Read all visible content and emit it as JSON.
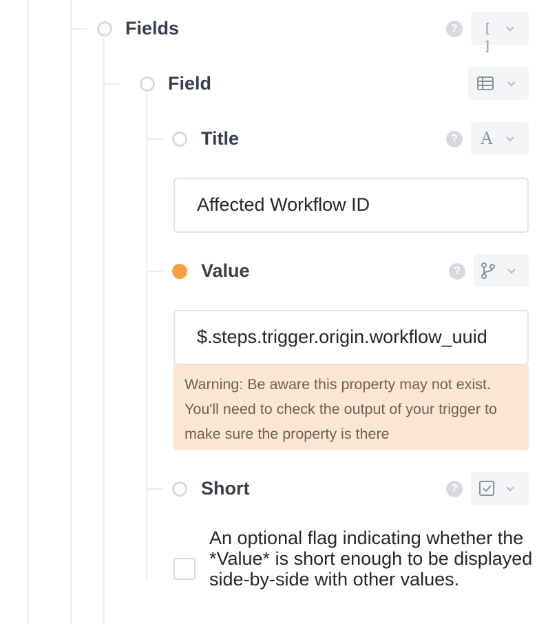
{
  "tree": {
    "fields": {
      "label": "Fields",
      "help": "?",
      "type_icon": "array-bracket-icon",
      "type_glyph": "[ ]"
    },
    "field": {
      "label": "Field",
      "type_icon": "table-icon"
    },
    "title": {
      "label": "Title",
      "help": "?",
      "type_icon": "text-type-icon",
      "type_glyph": "A",
      "value": "Affected Workflow ID"
    },
    "value": {
      "label": "Value",
      "help": "?",
      "type_icon": "git-branch-icon",
      "value": "$.steps.trigger.origin.workflow_uuid",
      "status_color": "#f5a142",
      "warning": "Warning: Be aware this property may not exist. You'll need to check the output of your trigger to make sure the property is there"
    },
    "short": {
      "label": "Short",
      "help": "?",
      "type_icon": "checkbox-icon",
      "checked": false,
      "description": "An optional flag indicating whether the *Value* is short enough to be displayed side-by-side with other values."
    }
  },
  "colors": {
    "accent_orange": "#f5a142",
    "warning_bg": "#fbe6d3",
    "tree_line": "#ececef"
  }
}
